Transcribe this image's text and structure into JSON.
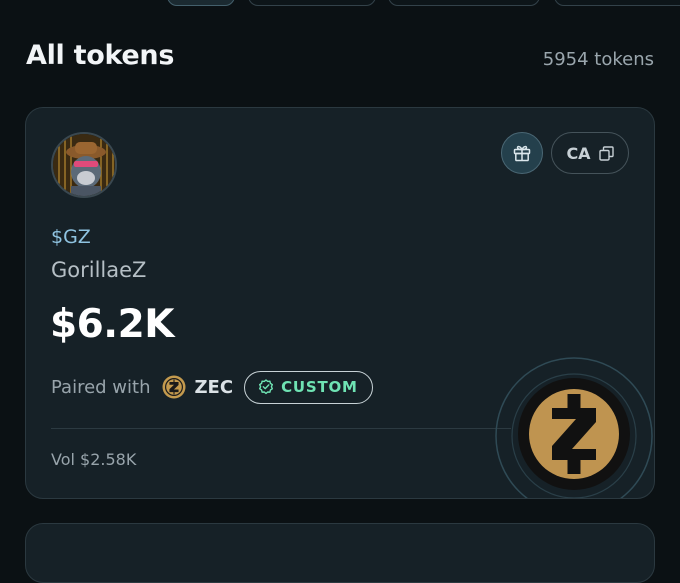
{
  "header": {
    "title": "All tokens",
    "count": "5954 tokens"
  },
  "token": {
    "ticker": "$GZ",
    "name": "GorillaeZ",
    "price": "$6.2K",
    "paired_label": "Paired with",
    "paired_symbol": "ZEC",
    "badge": "CUSTOM",
    "ca_label": "CA",
    "volume": "Vol $2.58K"
  },
  "colors": {
    "background": "#0b1114",
    "card": "#162127",
    "ticker_blue": "#8fc3e0",
    "badge_green": "#6fe3b3",
    "zec_gold": "#c39a4e"
  },
  "icons": [
    "gift-icon",
    "copy-icon",
    "check-badge-icon",
    "zec-coin-icon"
  ]
}
